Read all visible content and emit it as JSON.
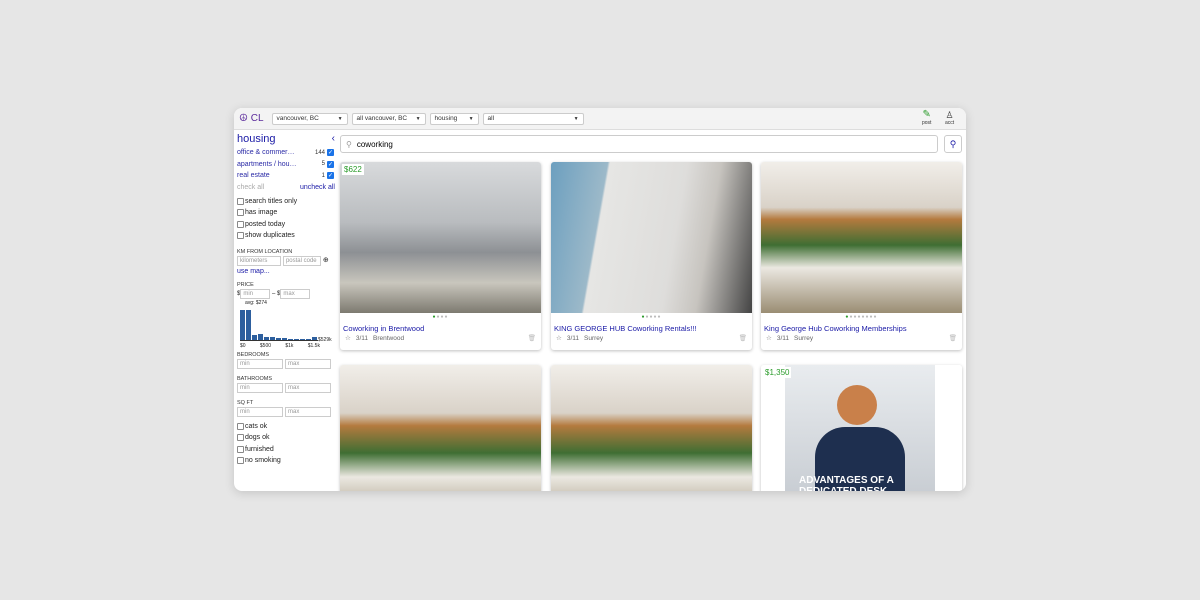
{
  "topbar": {
    "logo": "☮ CL",
    "region": "vancouver, BC",
    "subarea": "all vancouver, BC",
    "category": "housing",
    "subcategory": "all",
    "post": "post",
    "acct": "acct"
  },
  "sidebar": {
    "title": "housing",
    "categories": [
      {
        "label": "office & commer…",
        "count": "144"
      },
      {
        "label": "apartments / hou…",
        "count": "5"
      },
      {
        "label": "real estate",
        "count": "1"
      }
    ],
    "check_all": "check all",
    "uncheck_all": "uncheck all",
    "options": [
      "search titles only",
      "has image",
      "posted today",
      "show duplicates"
    ],
    "km_label": "KM FROM LOCATION",
    "km_placeholder": "kilometers",
    "postal_placeholder": "postal code",
    "use_map": "use map...",
    "price_label": "PRICE",
    "dollar": "$",
    "dash": "– $",
    "min": "min",
    "max": "max",
    "histogram": {
      "avg": "avg: $274",
      "ticks": [
        "$0",
        "$500",
        "$1k",
        "$1.5k"
      ],
      "end": "$529k",
      "bars": [
        1,
        1,
        0.15,
        0.18,
        0.1,
        0.1,
        0.06,
        0.06,
        0.03,
        0.03,
        0.03,
        0.03,
        0.08
      ]
    },
    "bedrooms": "BEDROOMS",
    "bathrooms": "BATHROOMS",
    "sqft": "SQ FT",
    "amenities": [
      "cats ok",
      "dogs ok",
      "furnished",
      "no smoking"
    ]
  },
  "search": {
    "query": "coworking"
  },
  "colors": {
    "link": "#1a1aa6",
    "price": "#2a9b2a",
    "accent": "#5b2a9b"
  },
  "listings": [
    {
      "price": "$622",
      "title": "Coworking in Brentwood",
      "date": "3/11",
      "location": "Brentwood",
      "images": 4
    },
    {
      "price": "",
      "title": "KING GEORGE HUB Coworking Rentals!!!",
      "date": "3/11",
      "location": "Surrey",
      "images": 5
    },
    {
      "price": "",
      "title": "King George Hub Coworking Memberships",
      "date": "3/11",
      "location": "Surrey",
      "images": 8
    },
    {
      "price": ""
    },
    {
      "price": ""
    },
    {
      "price": "$1,350",
      "ad_text": "ADVANTAGES OF A DEDICATED DESK"
    }
  ]
}
